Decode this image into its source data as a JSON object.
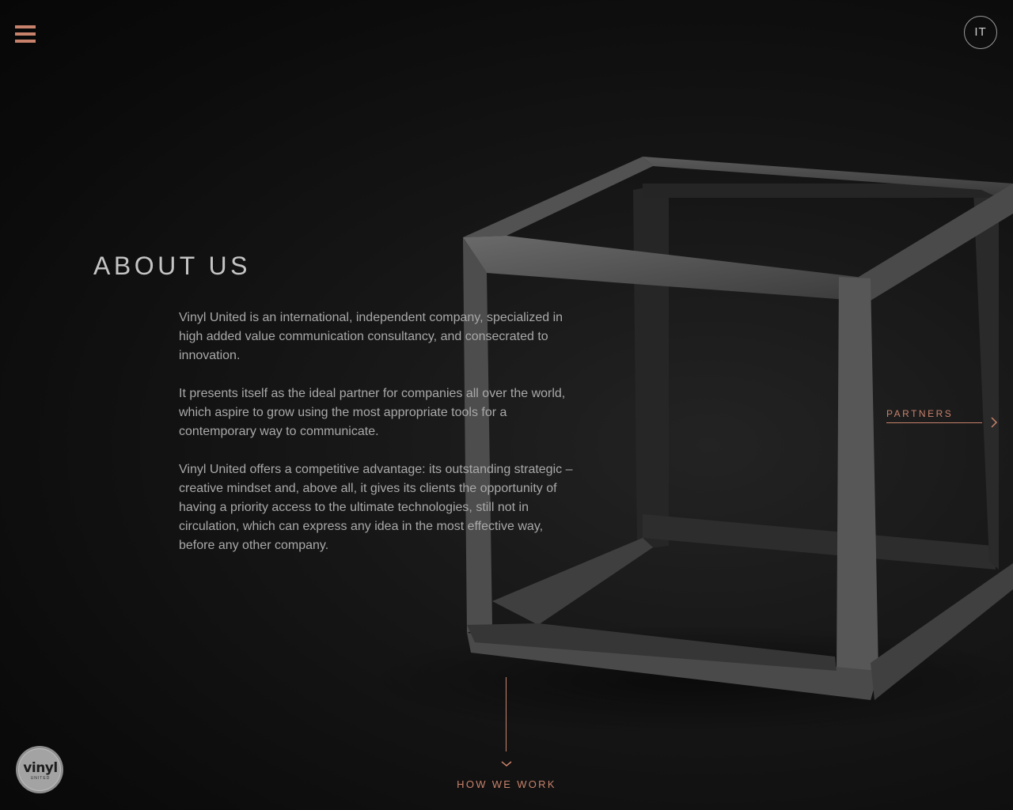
{
  "header": {
    "menu_icon": "hamburger-icon",
    "language_label": "IT"
  },
  "about": {
    "title": "ABOUT US",
    "paragraphs": [
      "Vinyl United is an international, independent company, specialized in high added value communication consultancy, and consecrated to innovation.",
      "It presents itself as the ideal partner for companies all over the world, which aspire to grow using the most appropriate tools for a contemporary way to communicate.",
      "Vinyl United offers a competitive advantage: its outstanding strategic – creative mindset and, above all, it gives its clients the opportunity of having a priority access to the ultimate technologies, still not in circulation, which can express any idea in the most effective way, before any other company."
    ]
  },
  "nav": {
    "next_label": "PARTNERS",
    "next_icon": "chevron-right-icon",
    "scroll_label": "HOW WE WORK",
    "scroll_icon": "chevron-down-icon"
  },
  "logo": {
    "word": "vinyl",
    "sub": "UNITED"
  },
  "colors": {
    "accent": "#c8826b",
    "background": "#0c0c0c",
    "text": "#a9a9a9",
    "title": "#c4c4c4"
  }
}
